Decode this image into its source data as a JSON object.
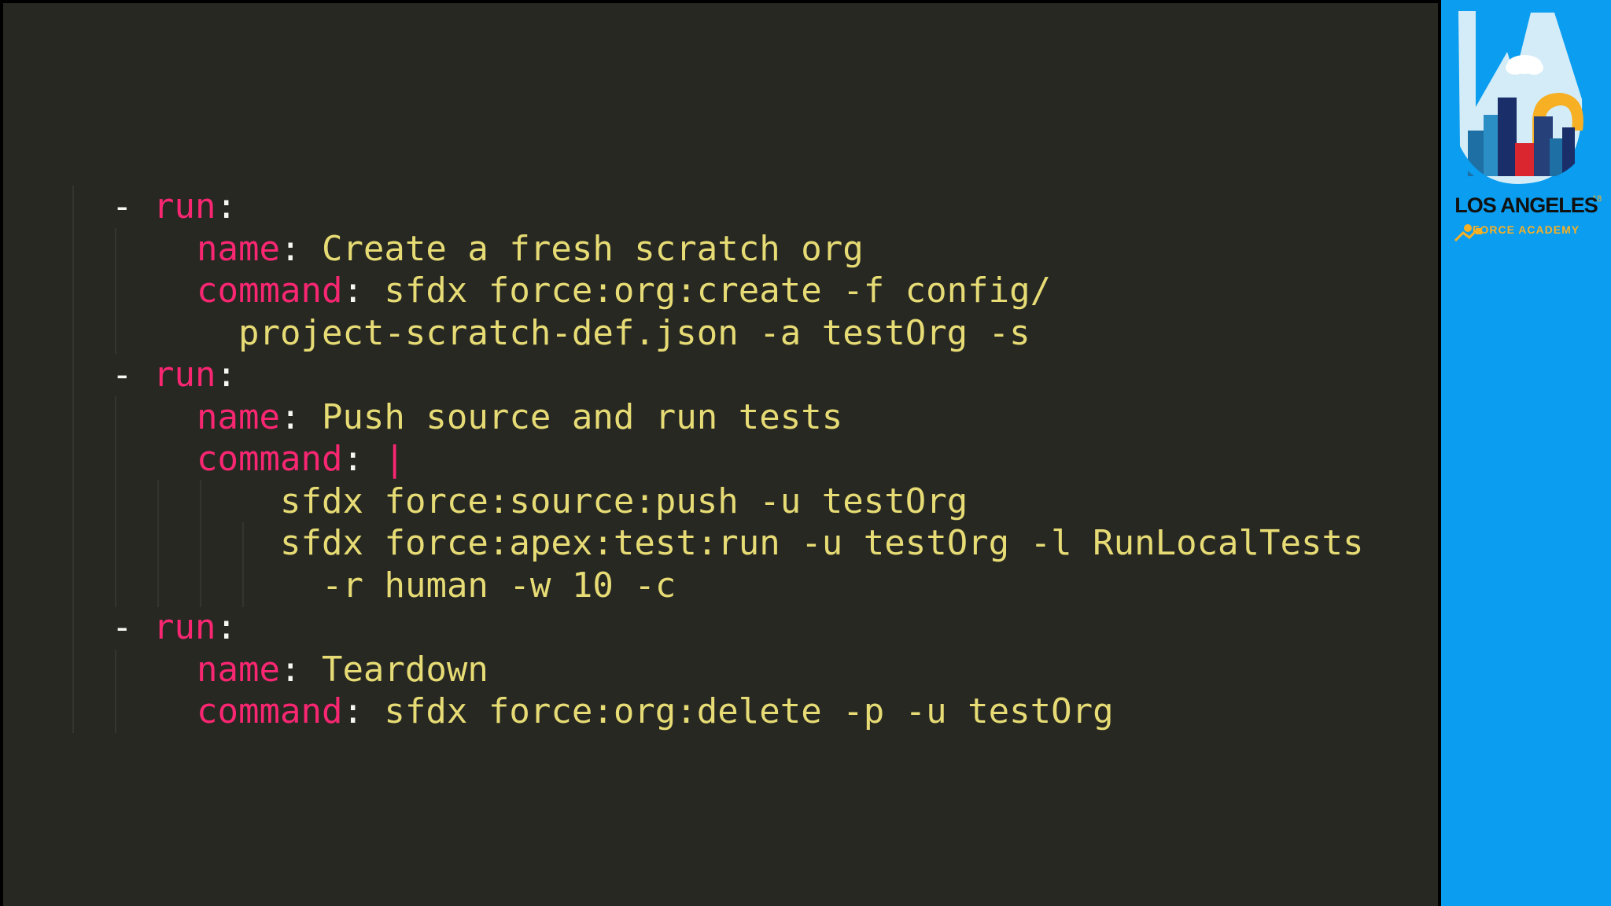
{
  "code": {
    "lines": [
      {
        "indent": 0,
        "dash": "- ",
        "key": "run",
        "punct": ":",
        "value": ""
      },
      {
        "indent": 2,
        "dash": "",
        "key": "name",
        "punct": ": ",
        "value": "Create a fresh scratch org"
      },
      {
        "indent": 2,
        "dash": "",
        "key": "command",
        "punct": ": ",
        "value": "sfdx force:org:create -f config/"
      },
      {
        "indent": 3,
        "dash": "",
        "key": "",
        "punct": "",
        "value": "project-scratch-def.json -a testOrg -s"
      },
      {
        "indent": 0,
        "dash": "- ",
        "key": "run",
        "punct": ":",
        "value": ""
      },
      {
        "indent": 2,
        "dash": "",
        "key": "name",
        "punct": ": ",
        "value": "Push source and run tests"
      },
      {
        "indent": 2,
        "dash": "",
        "key": "command",
        "punct": ": ",
        "value": "",
        "pipe": "|"
      },
      {
        "indent": 4,
        "dash": "",
        "key": "",
        "punct": "",
        "value": "sfdx force:source:push -u testOrg"
      },
      {
        "indent": 4,
        "dash": "",
        "key": "",
        "punct": "",
        "value": "sfdx force:apex:test:run -u testOrg -l RunLocalTests"
      },
      {
        "indent": 5,
        "dash": "",
        "key": "",
        "punct": "",
        "value": "-r human -w 10 -c"
      },
      {
        "indent": 0,
        "dash": "- ",
        "key": "run",
        "punct": ":",
        "value": ""
      },
      {
        "indent": 2,
        "dash": "",
        "key": "name",
        "punct": ": ",
        "value": "Teardown"
      },
      {
        "indent": 2,
        "dash": "",
        "key": "command",
        "punct": ": ",
        "value": "sfdx force:org:delete -p -u testOrg"
      }
    ]
  },
  "brand": {
    "city": "LOS ANGELES",
    "superscript": "18",
    "subtitle": "FORCE ACADEMY"
  },
  "colors": {
    "background": "#272822",
    "key": "#f92672",
    "value": "#e6db74",
    "sidebar": "#0a9df0"
  }
}
